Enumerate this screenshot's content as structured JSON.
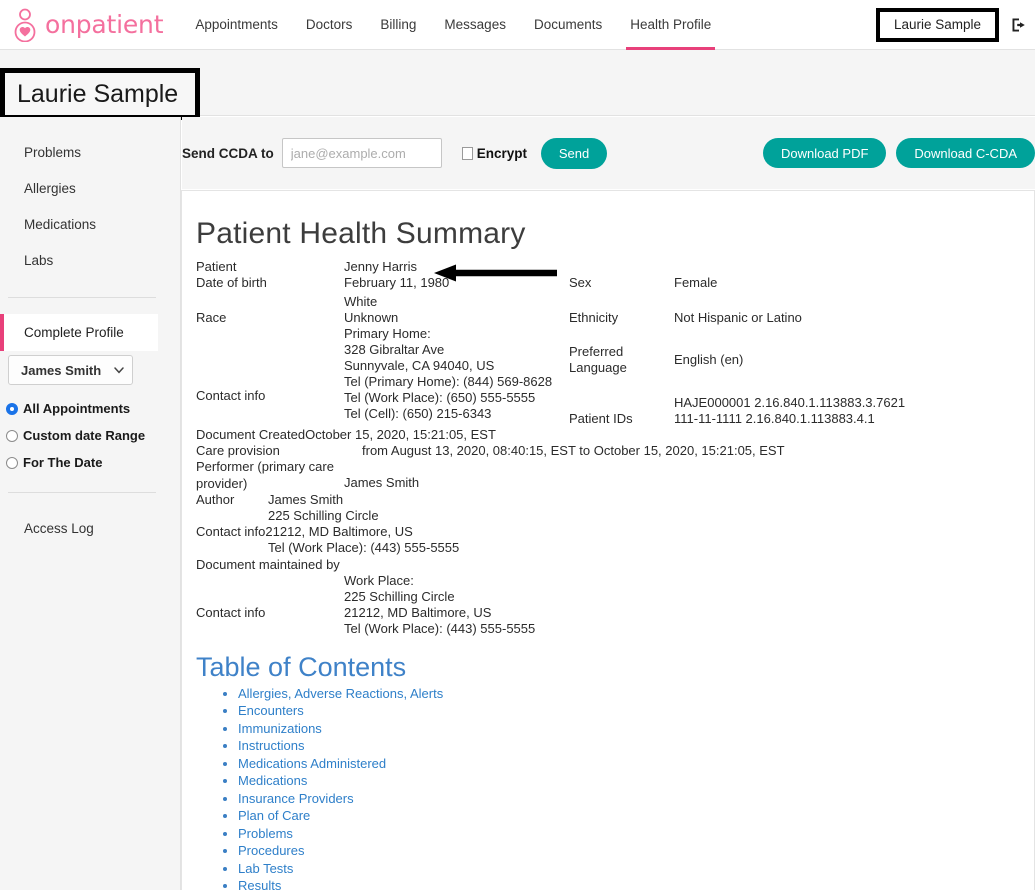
{
  "brand": {
    "name": "onpatient",
    "icon": "person-heart-logo-icon",
    "color": "#f4709e"
  },
  "nav": {
    "items": [
      {
        "label": "Appointments",
        "active": false
      },
      {
        "label": "Doctors",
        "active": false
      },
      {
        "label": "Billing",
        "active": false
      },
      {
        "label": "Messages",
        "active": false
      },
      {
        "label": "Documents",
        "active": false
      },
      {
        "label": "Health Profile",
        "active": true
      }
    ],
    "user_chip": "Laurie Sample",
    "logout_icon": "logout-icon",
    "active_underline_color": "#e8407a"
  },
  "page": {
    "title": "Laurie Sample"
  },
  "sidebar": {
    "items": [
      {
        "label": "Problems"
      },
      {
        "label": "Allergies"
      },
      {
        "label": "Medications"
      },
      {
        "label": "Labs"
      }
    ],
    "complete_profile": "Complete Profile",
    "provider_select": {
      "value": "James Smith",
      "icon": "chevron-down-icon"
    },
    "radios": [
      {
        "label": "All Appointments",
        "checked": true
      },
      {
        "label": "Custom date Range",
        "checked": false
      },
      {
        "label": "For The Date",
        "checked": false
      }
    ],
    "access_log": "Access Log",
    "accent_color": "#e8407a"
  },
  "toolbar": {
    "send_ccda_label": "Send CCDA to",
    "email_placeholder": "jane@example.com",
    "email_value": "",
    "encrypt_label": "Encrypt",
    "encrypt_checked": false,
    "send_label": "Send",
    "download_pdf_label": "Download PDF",
    "download_ccda_label": "Download C-CDA",
    "button_color": "#00a29a"
  },
  "summary": {
    "title": "Patient Health Summary",
    "patient_label": "Patient",
    "patient_value": "Jenny Harris",
    "dob_label": "Date of birth",
    "dob_value": "February 11, 1980",
    "race_label": "Race",
    "race_value_1": "White",
    "race_value_2": "Unknown",
    "sex_label": "Sex",
    "sex_value": "Female",
    "ethnicity_label": "Ethnicity",
    "ethnicity_value": "Not Hispanic or Latino",
    "preferred_language_label_1": "Preferred",
    "preferred_language_label_2": "Language",
    "preferred_language_value": "English (en)",
    "contact_info_label": "Contact info",
    "contact_lines": [
      "Primary Home:",
      "328 Gibraltar Ave",
      "Sunnyvale, CA 94040, US",
      "Tel (Primary Home): (844) 569-8628",
      "Tel (Work Place): (650) 555-5555",
      "Tel (Cell): (650) 215-6343"
    ],
    "patient_ids_label": "Patient IDs",
    "patient_ids": [
      "HAJE000001 2.16.840.1.113883.3.7621",
      "111-11-1111 2.16.840.1.113883.4.1"
    ],
    "document_created_label": "Document Created",
    "document_created_value": "October 15, 2020, 15:21:05, EST",
    "care_provision_label": "Care provision",
    "care_provision_value": "from August 13, 2020, 08:40:15, EST to October 15, 2020, 15:21:05, EST",
    "performer_label_1": "Performer (primary care",
    "performer_label_2": "provider)",
    "performer_value": "James Smith",
    "author_label": "Author",
    "author_value": "James Smith",
    "author_address_line": "225 Schilling Circle",
    "author_contact_label": "Contact info",
    "author_contact_city": "21212, MD Baltimore, US",
    "author_contact_tel": "Tel (Work Place): (443) 555-5555",
    "maintained_by_label": "Document maintained by",
    "maintainer_contact_label": "Contact info",
    "maintainer_lines": [
      "Work Place:",
      "225 Schilling Circle",
      "21212, MD Baltimore, US",
      "Tel (Work Place): (443) 555-5555"
    ],
    "annotation_arrow": "left-pointing-arrow-to-patient-name"
  },
  "toc": {
    "title": "Table of Contents",
    "links": [
      "Allergies, Adverse Reactions, Alerts",
      "Encounters",
      "Immunizations",
      "Instructions",
      "Medications Administered",
      "Medications",
      "Insurance Providers",
      "Plan of Care",
      "Problems",
      "Procedures",
      "Lab Tests",
      "Results"
    ],
    "link_color": "#2e7fc9"
  }
}
